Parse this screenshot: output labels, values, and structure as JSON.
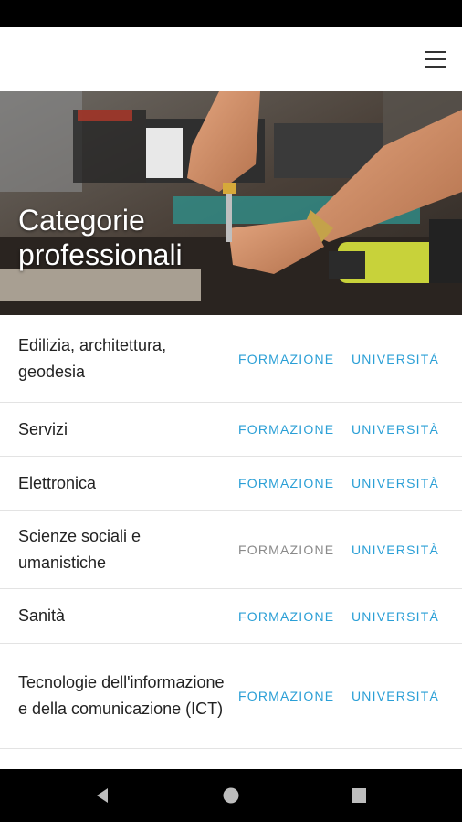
{
  "hero": {
    "title_line1": "Categorie",
    "title_line2": "professionali"
  },
  "categories": [
    {
      "name": "Edilizia, architettura, geodesia",
      "formazione": "FORMAZIONE",
      "universita": "UNIVERSITÀ",
      "formazione_enabled": true
    },
    {
      "name": "Servizi",
      "formazione": "FORMAZIONE",
      "universita": "UNIVERSITÀ",
      "formazione_enabled": true
    },
    {
      "name": "Elettronica",
      "formazione": "FORMAZIONE",
      "universita": "UNIVERSITÀ",
      "formazione_enabled": true
    },
    {
      "name": "Scienze sociali e umanistiche",
      "formazione": "FORMAZIONE",
      "universita": "UNIVERSITÀ",
      "formazione_enabled": false
    },
    {
      "name": "Sanità",
      "formazione": "FORMAZIONE",
      "universita": "UNIVERSITÀ",
      "formazione_enabled": true
    },
    {
      "name": "Tecnologie dell'informazione e della comunicazione (ICT)",
      "formazione": "FORMAZIONE",
      "universita": "UNIVERSITÀ",
      "formazione_enabled": true
    }
  ],
  "colors": {
    "link": "#2a9fd6",
    "link_disabled": "#8a8a8a",
    "text": "#222222",
    "divider": "#e3e3e3"
  },
  "icons": {
    "menu": "hamburger-menu-icon",
    "back": "back-triangle-icon",
    "home": "home-circle-icon",
    "recents": "recents-square-icon"
  }
}
